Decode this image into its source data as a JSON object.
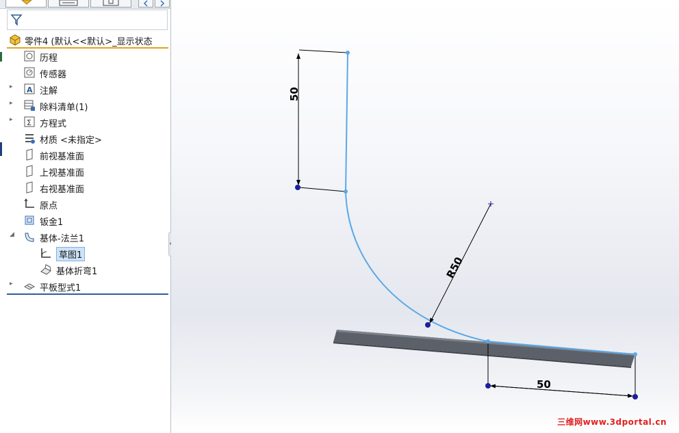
{
  "panel": {
    "part_label": "零件4 (默认<<默认>_显示状态",
    "tree": [
      {
        "label": "历程",
        "icon": "history-icon",
        "expandable": false
      },
      {
        "label": "传感器",
        "icon": "sensor-icon",
        "expandable": false
      },
      {
        "label": "注解",
        "icon": "annotation-icon",
        "expandable": true
      },
      {
        "label": "除料清单(1)",
        "icon": "cutlist-icon",
        "expandable": true
      },
      {
        "label": "方程式",
        "icon": "equation-icon",
        "expandable": true
      },
      {
        "label": "材质 <未指定>",
        "icon": "material-icon",
        "expandable": false
      },
      {
        "label": "前视基准面",
        "icon": "plane-icon",
        "expandable": false
      },
      {
        "label": "上视基准面",
        "icon": "plane-icon",
        "expandable": false
      },
      {
        "label": "右视基准面",
        "icon": "plane-icon",
        "expandable": false
      },
      {
        "label": "原点",
        "icon": "origin-icon",
        "expandable": false
      },
      {
        "label": "钣金1",
        "icon": "sheetmetal-icon",
        "expandable": false
      },
      {
        "label": "基体-法兰1",
        "icon": "base-flange-icon",
        "expandable": "open"
      },
      {
        "label": "草图1",
        "icon": "sketch-icon",
        "expandable": false,
        "child": true,
        "selected": true
      },
      {
        "label": "基体折弯1",
        "icon": "bend-icon",
        "expandable": false,
        "child": true
      },
      {
        "label": "平板型式1",
        "icon": "flat-pattern-icon",
        "expandable": true
      }
    ]
  },
  "viewport": {
    "dim_vertical": "50",
    "dim_radius": "R50",
    "dim_horizontal": "50",
    "watermark": "三维网www.3dportal.cn"
  },
  "colors": {
    "sketch_line": "#5aa8e8",
    "point": "#1a1f9e",
    "dimension": "#000000",
    "part_header_underline": "#e0a320",
    "selection": "#cde3f7",
    "watermark": "#e02020"
  }
}
